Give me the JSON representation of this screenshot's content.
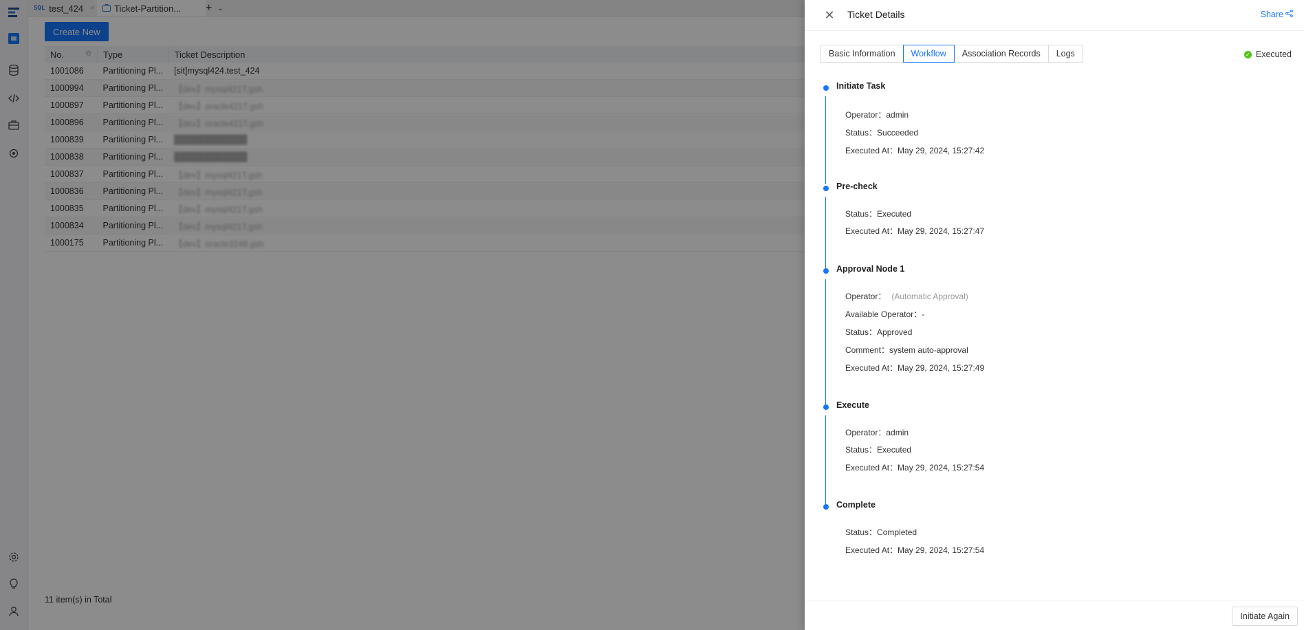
{
  "tabs": [
    {
      "badge": "SQL",
      "label": "test_424"
    },
    {
      "label": "Ticket-Partition..."
    }
  ],
  "list": {
    "create_label": "Create New",
    "columns": [
      "No.",
      "Type",
      "Ticket Description"
    ],
    "rows": [
      {
        "no": "1001086",
        "type": "Partitioning Pl...",
        "desc": "[sit]mysql424.test_424"
      },
      {
        "no": "1000994",
        "type": "Partitioning Pl...",
        "desc": "【dev】mysql421T.gsh"
      },
      {
        "no": "1000897",
        "type": "Partitioning Pl...",
        "desc": "【dev】oracle421T.gsh"
      },
      {
        "no": "1000896",
        "type": "Partitioning Pl...",
        "desc": "【dev】oracle421T.gsh"
      },
      {
        "no": "1000839",
        "type": "Partitioning Pl...",
        "desc": "████████████"
      },
      {
        "no": "1000838",
        "type": "Partitioning Pl...",
        "desc": "████████████"
      },
      {
        "no": "1000837",
        "type": "Partitioning Pl...",
        "desc": "【dev】mysql421T.gsh"
      },
      {
        "no": "1000836",
        "type": "Partitioning Pl...",
        "desc": "【dev】mysql421T.gsh"
      },
      {
        "no": "1000835",
        "type": "Partitioning Pl...",
        "desc": "【dev】mysql421T.gsh"
      },
      {
        "no": "1000834",
        "type": "Partitioning Pl...",
        "desc": "【dev】mysql421T.gsh"
      },
      {
        "no": "1000175",
        "type": "Partitioning Pl...",
        "desc": "【dev】oracle3248.gsh"
      }
    ],
    "total": "11 item(s) in Total"
  },
  "drawer": {
    "title": "Ticket Details",
    "share_label": "Share",
    "tabs": [
      "Basic Information",
      "Workflow",
      "Association Records",
      "Logs"
    ],
    "status": "Executed",
    "steps": [
      {
        "name": "Initiate Task",
        "rows": [
          {
            "k": "Operator：",
            "v": "admin"
          },
          {
            "k": "Status：",
            "v": "Succeeded"
          },
          {
            "k": "Executed At：",
            "v": "May 29, 2024, 15:27:42"
          }
        ]
      },
      {
        "name": "Pre-check",
        "rows": [
          {
            "k": "Status：",
            "v": "Executed"
          },
          {
            "k": "Executed At：",
            "v": "May 29, 2024, 15:27:47"
          }
        ]
      },
      {
        "name": "Approval Node 1",
        "rows": [
          {
            "k": "Operator：",
            "v": "(Automatic Approval)"
          },
          {
            "k": "Available Operator：",
            "v": "-"
          },
          {
            "k": "Status：",
            "v": "Approved"
          },
          {
            "k": "Comment：",
            "v": "system auto-approval"
          },
          {
            "k": "Executed At：",
            "v": "May 29, 2024, 15:27:49"
          }
        ]
      },
      {
        "name": "Execute",
        "rows": [
          {
            "k": "Operator：",
            "v": "admin"
          },
          {
            "k": "Status：",
            "v": "Executed"
          },
          {
            "k": "Executed At：",
            "v": "May 29, 2024, 15:27:54"
          }
        ]
      },
      {
        "name": "Complete",
        "rows": [
          {
            "k": "Status：",
            "v": "Completed"
          },
          {
            "k": "Executed At：",
            "v": "May 29, 2024, 15:27:54"
          }
        ]
      }
    ],
    "footer_button": "Initiate Again"
  }
}
